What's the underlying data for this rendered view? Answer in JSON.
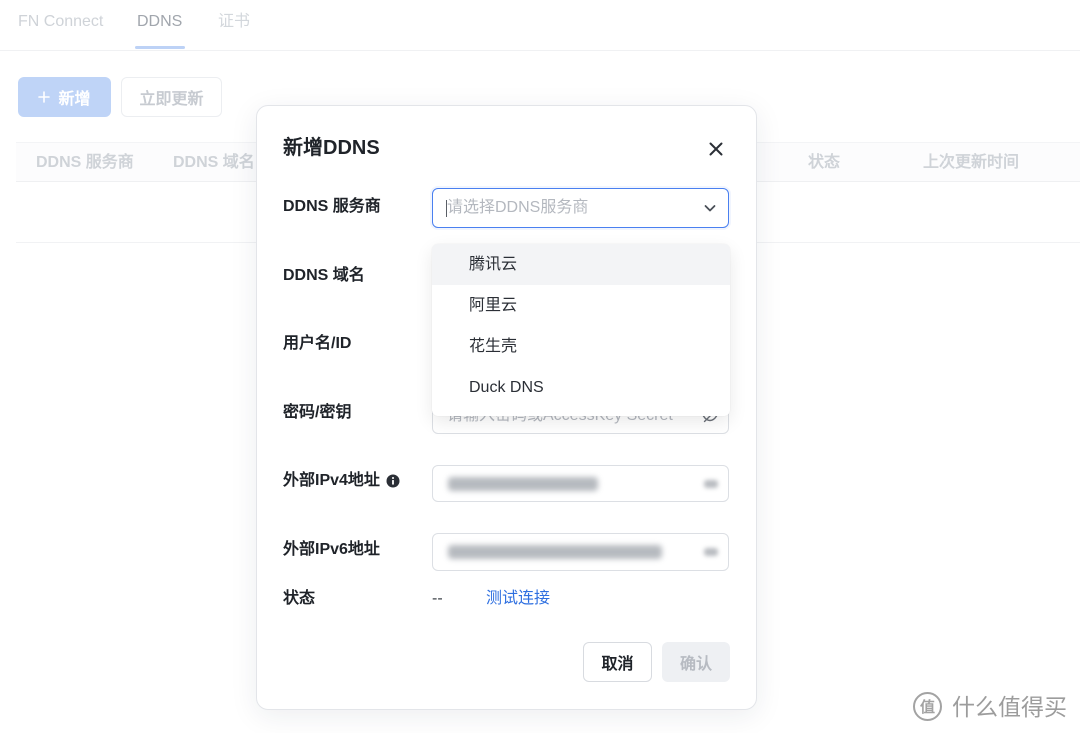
{
  "tabs": [
    {
      "label": "FN Connect",
      "active": false
    },
    {
      "label": "DDNS",
      "active": true
    },
    {
      "label": "证书",
      "active": false
    }
  ],
  "toolbar": {
    "add_label": "新增",
    "update_label": "立即更新"
  },
  "table": {
    "headers": [
      "DDNS 服务商",
      "DDNS 域名",
      "状态",
      "上次更新时间"
    ]
  },
  "dialog": {
    "title": "新增DDNS",
    "provider": {
      "label": "DDNS 服务商",
      "placeholder": "请选择DDNS服务商",
      "options": [
        "腾讯云",
        "阿里云",
        "花生壳",
        "Duck DNS"
      ],
      "highlighted_option": "腾讯云",
      "dropdown_open": true
    },
    "domain": {
      "label": "DDNS 域名"
    },
    "username": {
      "label": "用户名/ID"
    },
    "password": {
      "label": "密码/密钥",
      "placeholder": "请输入密码或AccessKey Secret"
    },
    "ipv4": {
      "label": "外部IPv4地址",
      "value_blurred": true
    },
    "ipv6": {
      "label": "外部IPv6地址",
      "value_blurred": true
    },
    "status": {
      "label": "状态",
      "value": "--",
      "test_link": "测试连接"
    },
    "cancel_label": "取消",
    "confirm_label": "确认",
    "confirm_disabled": true
  },
  "watermark": {
    "logo_glyph": "值",
    "text": "什么值得买"
  },
  "icons": {
    "add": "plus-icon",
    "close": "close-icon",
    "select_arrow": "chevron-down-icon",
    "info": "info-icon",
    "password_toggle": "eye-icon"
  },
  "colors": {
    "accent": "#4a80f0",
    "link": "#2e6fe0",
    "text_primary": "#1f2329",
    "placeholder": "#b4b8bf",
    "disabled_bg": "#eef0f3",
    "disabled_text": "#b7bbc2",
    "option_highlight": "#f3f4f6"
  }
}
